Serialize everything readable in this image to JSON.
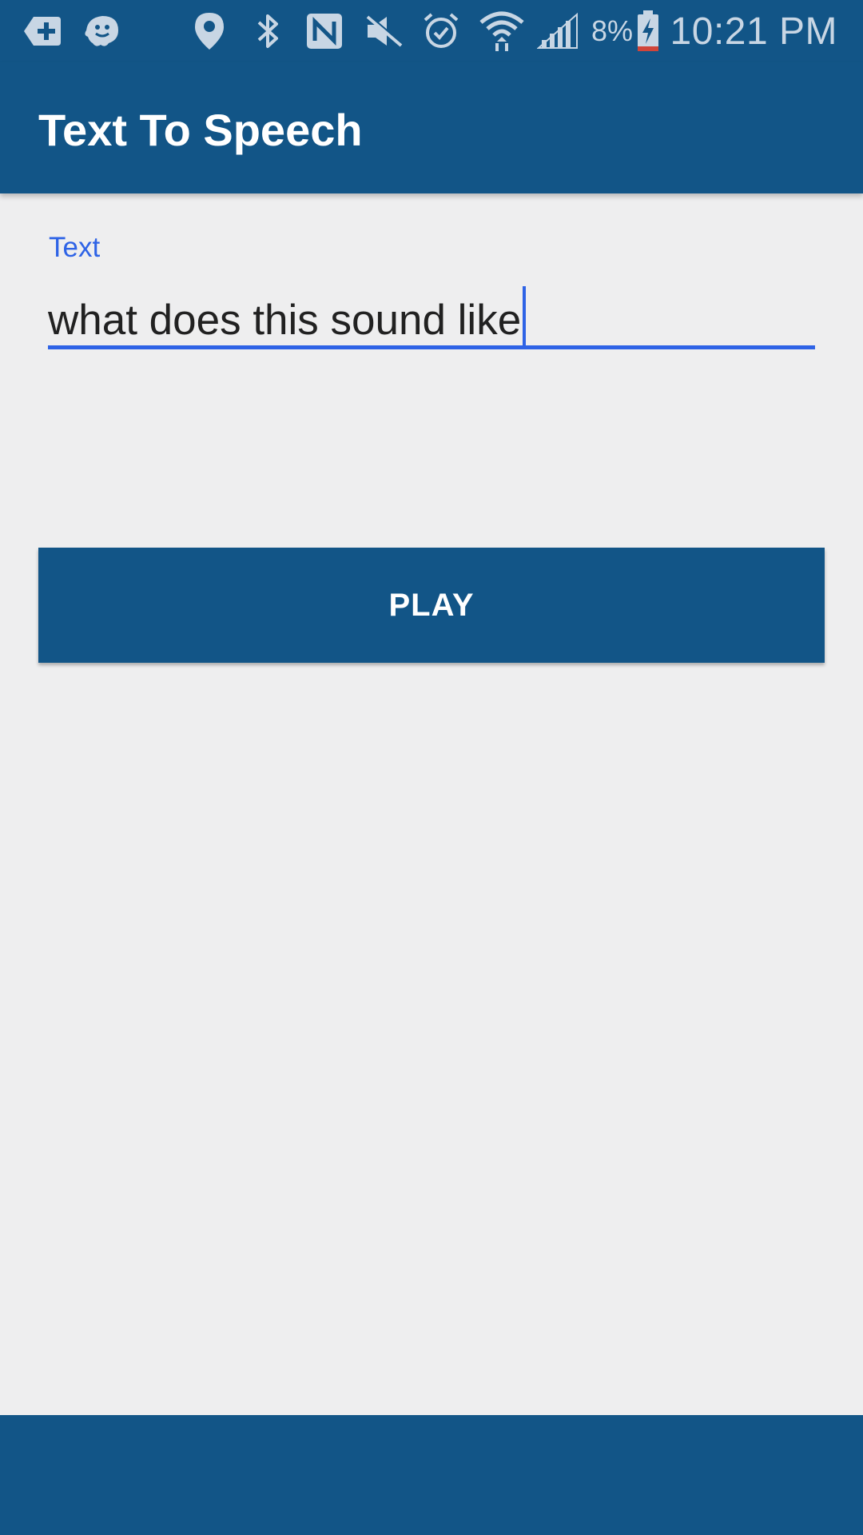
{
  "status_bar": {
    "battery_percent": "8%",
    "time": "10:21 PM",
    "icons": [
      "add-notification-icon",
      "waze-icon",
      "location-icon",
      "bluetooth-icon",
      "nfc-icon",
      "mute-icon",
      "alarm-icon",
      "wifi-icon",
      "signal-icon",
      "battery-charging-icon"
    ]
  },
  "app_bar": {
    "title": "Text To Speech"
  },
  "text_field": {
    "label": "Text",
    "value": "what does this sound like"
  },
  "play_button": {
    "label": "PLAY"
  },
  "colors": {
    "primary": "#125587",
    "accent": "#2e63e6",
    "background": "#eeeeef",
    "text": "#212121"
  }
}
